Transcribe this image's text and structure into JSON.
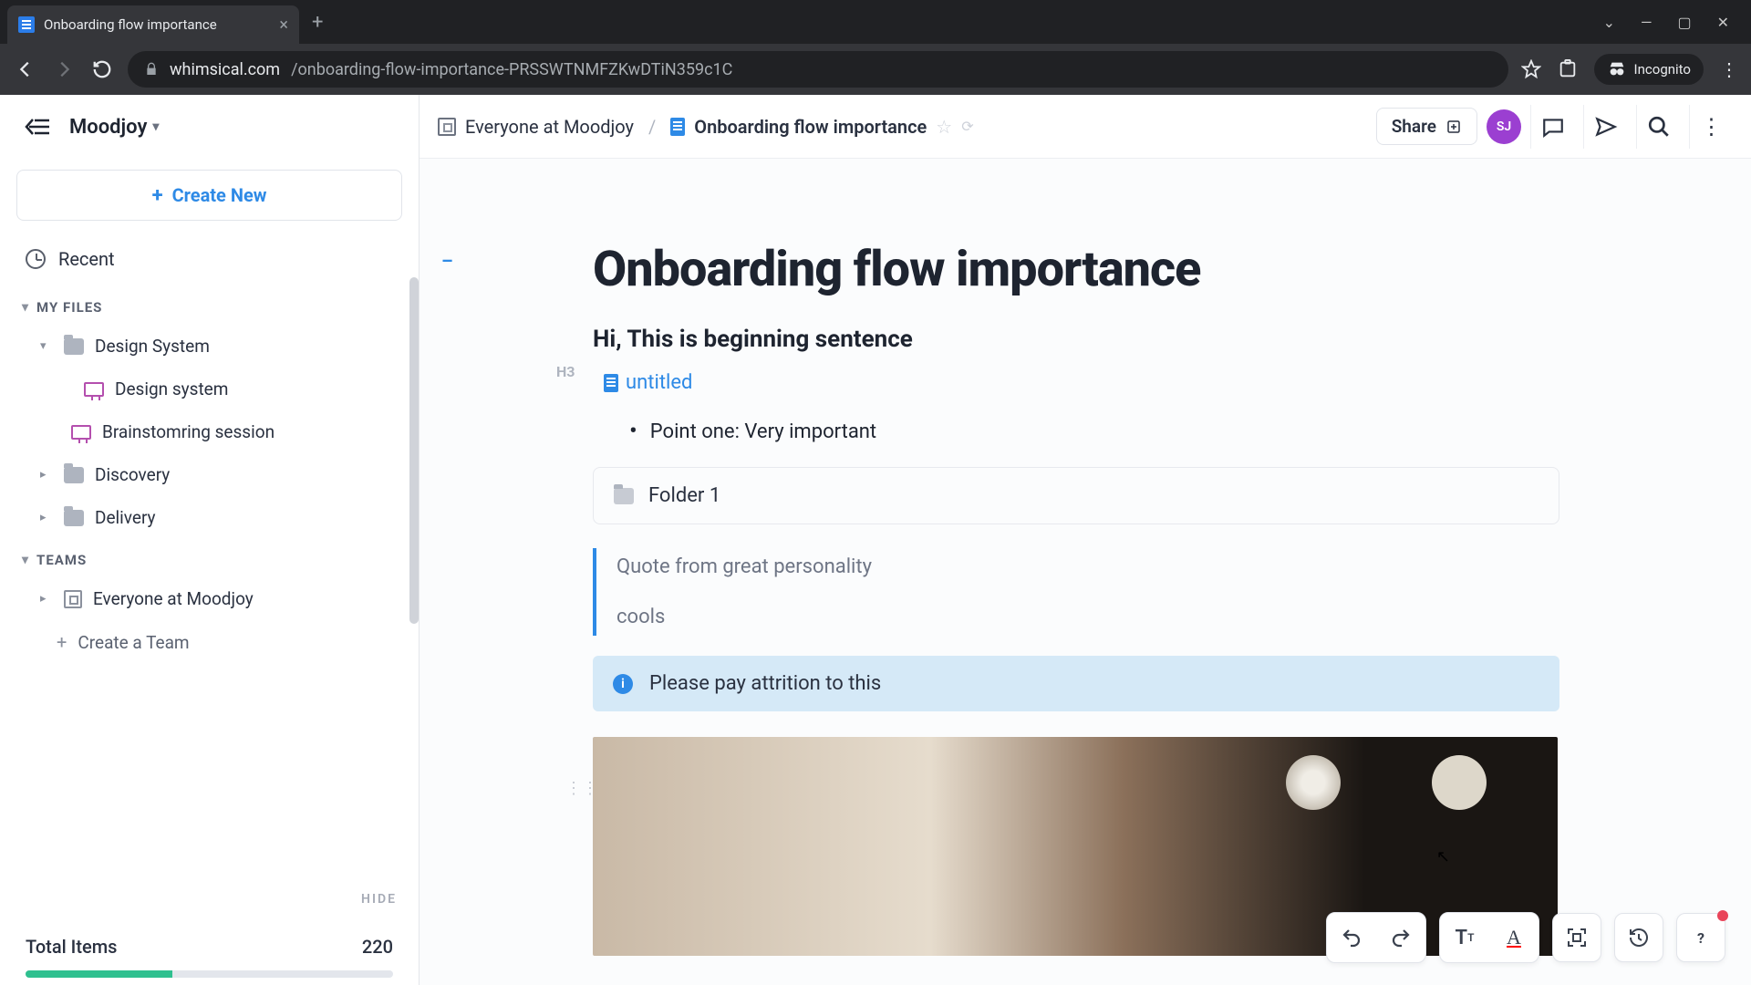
{
  "browser": {
    "tab_title": "Onboarding flow importance",
    "url_host": "whimsical.com",
    "url_path": "/onboarding-flow-importance-PRSSWTNMFZKwDTiN359c1C",
    "incognito": "Incognito"
  },
  "workspace": {
    "name": "Moodjoy",
    "create_label": "Create New",
    "recent_label": "Recent",
    "sections": {
      "my_files": "MY FILES",
      "teams": "TEAMS"
    },
    "tree": {
      "design_system_folder": "Design System",
      "design_system_board": "Design system",
      "brainstorming_board": "Brainstomring session",
      "discovery": "Discovery",
      "delivery": "Delivery",
      "everyone": "Everyone at Moodjoy",
      "create_team": "Create a Team"
    },
    "hide_label": "HIDE",
    "total_items_label": "Total Items",
    "total_items_value": "220"
  },
  "header": {
    "breadcrumb_root": "Everyone at Moodjoy",
    "breadcrumb_doc": "Onboarding flow importance",
    "share": "Share",
    "avatar": "SJ"
  },
  "document": {
    "title": "Onboarding flow importance",
    "h3_marker": "H3",
    "h3_text": "Hi, This is beginning sentence",
    "linked_doc": "untitled",
    "bullet1": "Point one: Very important",
    "folder_block": "Folder 1",
    "quote_line1": "Quote from great personality",
    "quote_line2": "cools",
    "callout": "Please pay attrition to this",
    "outline_dash": "–"
  }
}
